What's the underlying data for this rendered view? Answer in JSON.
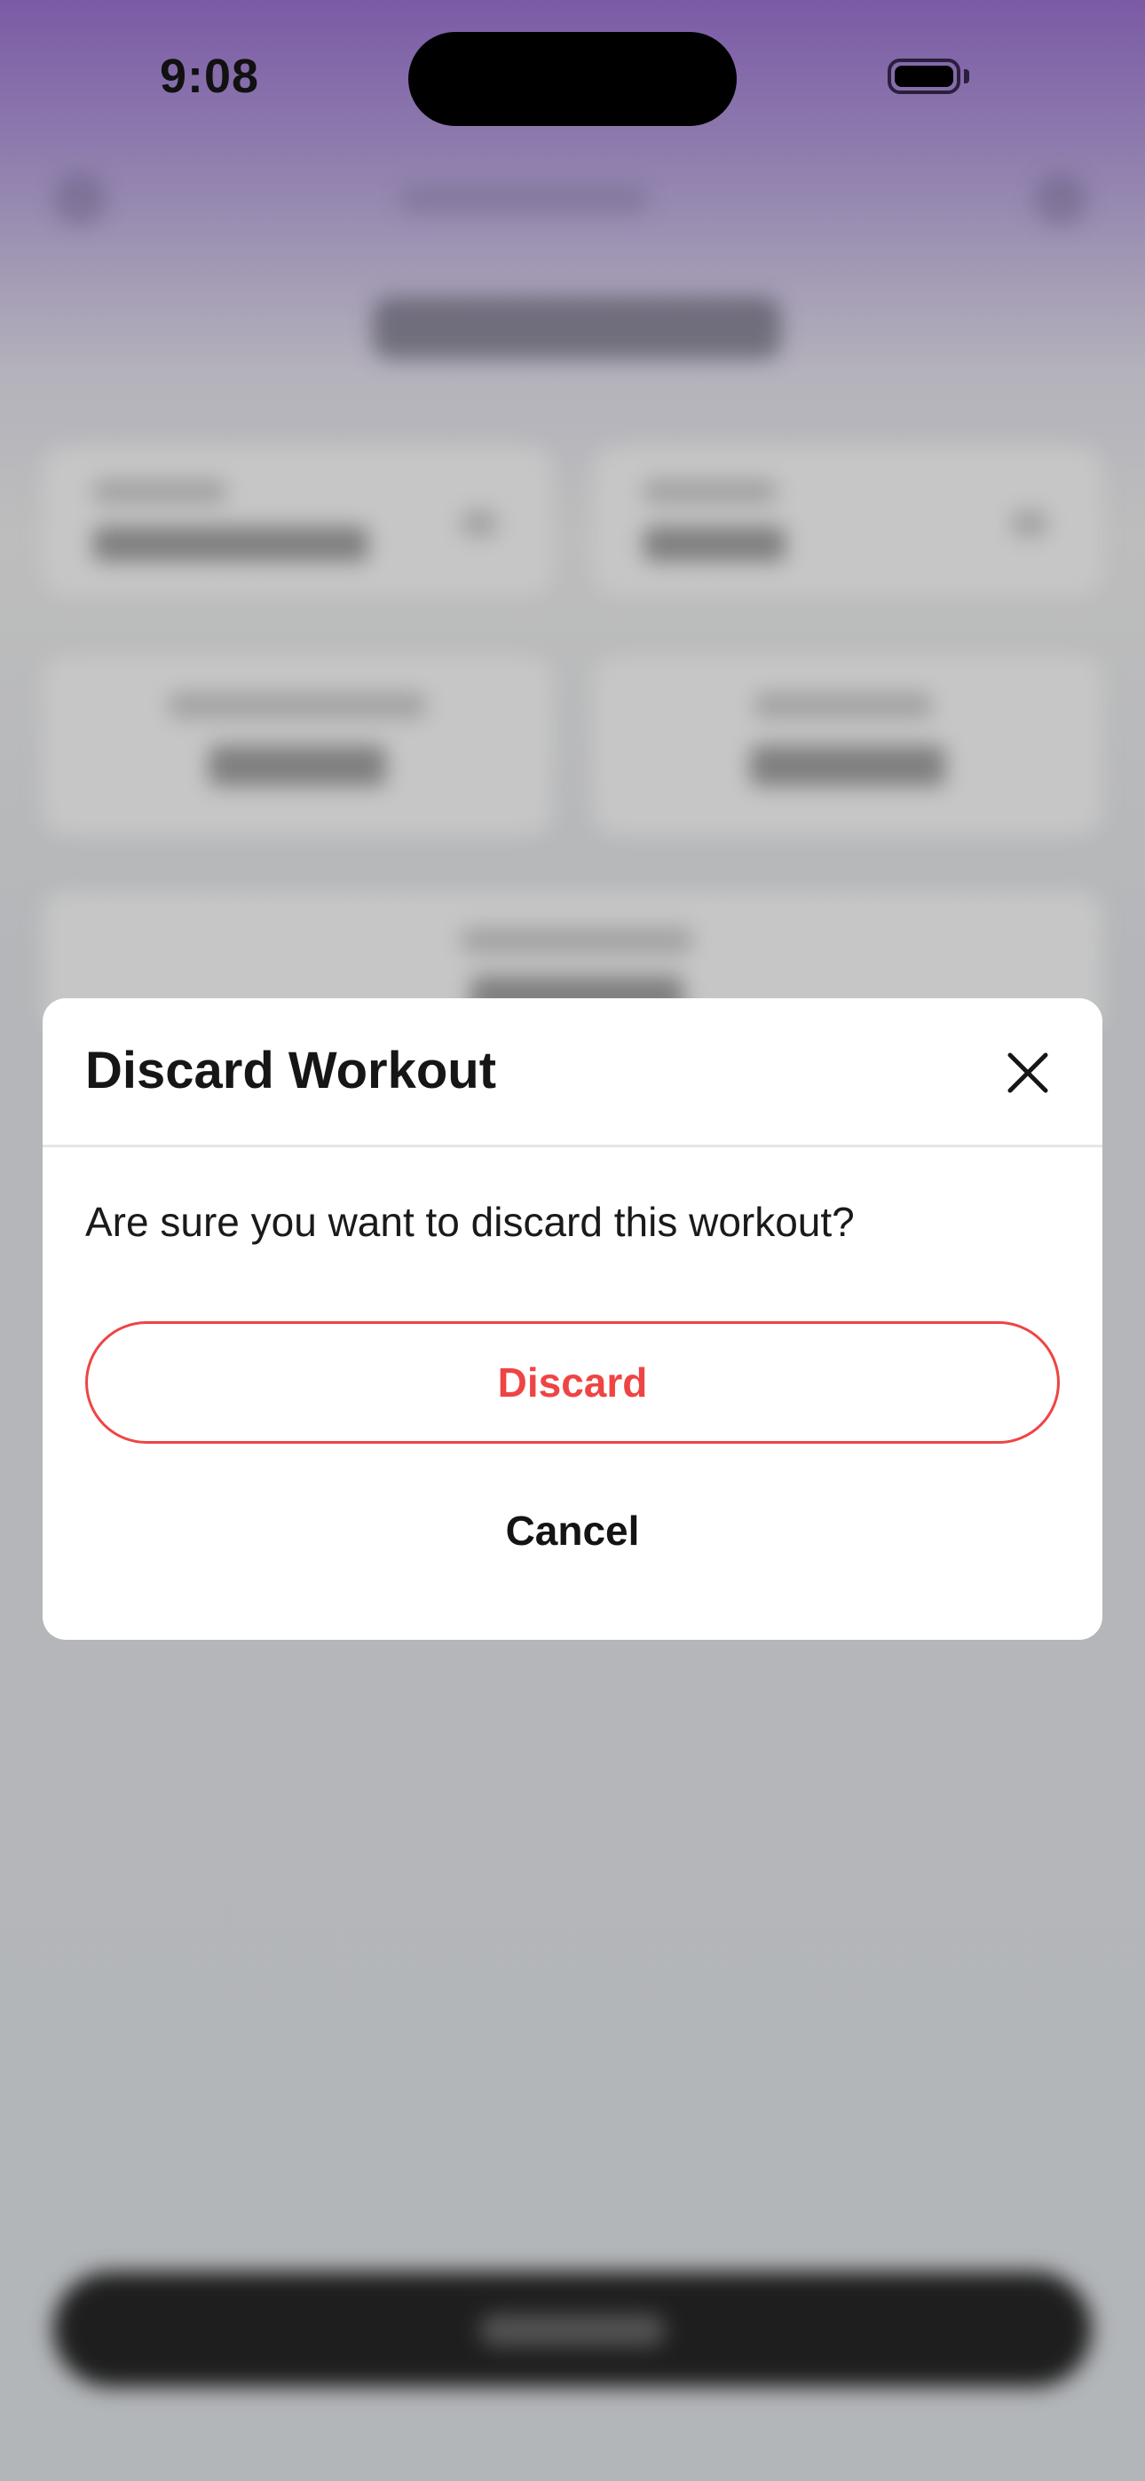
{
  "status_bar": {
    "time": "9:08"
  },
  "dialog": {
    "title": "Discard Workout",
    "message": "Are sure you want to discard this workout?",
    "discard_label": "Discard",
    "cancel_label": "Cancel",
    "close_icon": "close-icon"
  },
  "colors": {
    "accent_red": "#ef4444",
    "header_purple": "#7b5aa6"
  }
}
